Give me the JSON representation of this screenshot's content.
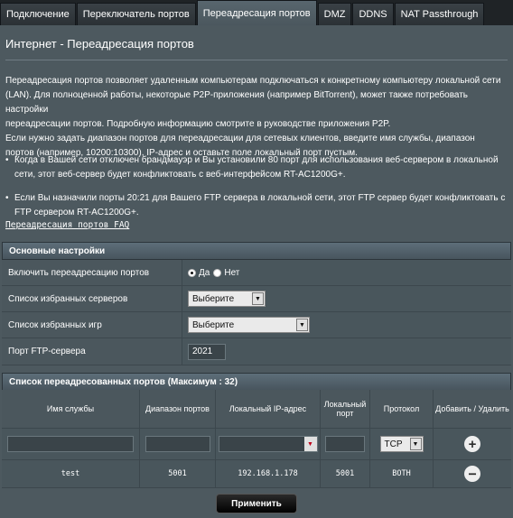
{
  "tabs": [
    {
      "label": "Подключение"
    },
    {
      "label": "Переключатель портов"
    },
    {
      "label": "Переадресация портов"
    },
    {
      "label": "DMZ"
    },
    {
      "label": "DDNS"
    },
    {
      "label": "NAT Passthrough"
    }
  ],
  "page": {
    "title": "Интернет - Переадресация портов",
    "description_lines": [
      "Переадресация портов позволяет удаленным компьютерам подключаться к конкретному компьютеру локальной сети",
      "(LAN). Для полноценной работы, некоторые P2P-приложения (например BitTorrent), может также потребовать настройки",
      "переадресации портов. Подробную информацию смотрите в руководстве приложения P2P.",
      "Если нужно задать диапазон портов для переадресации для сетевых клиентов, введите имя службы, диапазон",
      "портов (например, 10200:10300), IP-адрес и оставьте поле локальный порт пустым."
    ],
    "bullets": [
      "Когда в Вашей сети отключен брандмауэр и Вы установили 80 порт для использования веб-сервером в локальной сети, этот веб-сервер будет конфликтовать с веб-интерфейсом RT-AC1200G+.",
      "Если Вы назначили порты 20:21 для Вашего FTP сервера в локальной сети, этот FTP сервер будет конфликтовать с FTP сервером RT-AC1200G+."
    ],
    "faq_link": "Переадресация портов FAQ"
  },
  "basic": {
    "header": "Основные настройки",
    "enable_label": "Включить переадресацию портов",
    "yes": "Да",
    "no": "Нет",
    "enabled": true,
    "servers_label": "Список избранных серверов",
    "servers_value": "Выберите",
    "games_label": "Список избранных игр",
    "games_value": "Выберите",
    "ftp_label": "Порт FTP-сервера",
    "ftp_value": "2021"
  },
  "portlist": {
    "header": "Список переадресованных портов (Максимум : 32)",
    "columns": {
      "service": "Имя службы",
      "range": "Диапазон портов",
      "ip": "Локальный IP-адрес",
      "local_port": "Локальный порт",
      "protocol": "Протокол",
      "action": "Добавить / Удалить"
    },
    "new_protocol": "TCP",
    "rows": [
      {
        "service": "test",
        "range": "5001",
        "ip": "192.168.1.178",
        "local_port": "5001",
        "protocol": "BOTH"
      }
    ]
  },
  "apply_label": "Применить",
  "icons": {
    "dropdown": "chevron-down-icon",
    "add": "plus-circle-icon",
    "remove": "minus-circle-icon"
  }
}
